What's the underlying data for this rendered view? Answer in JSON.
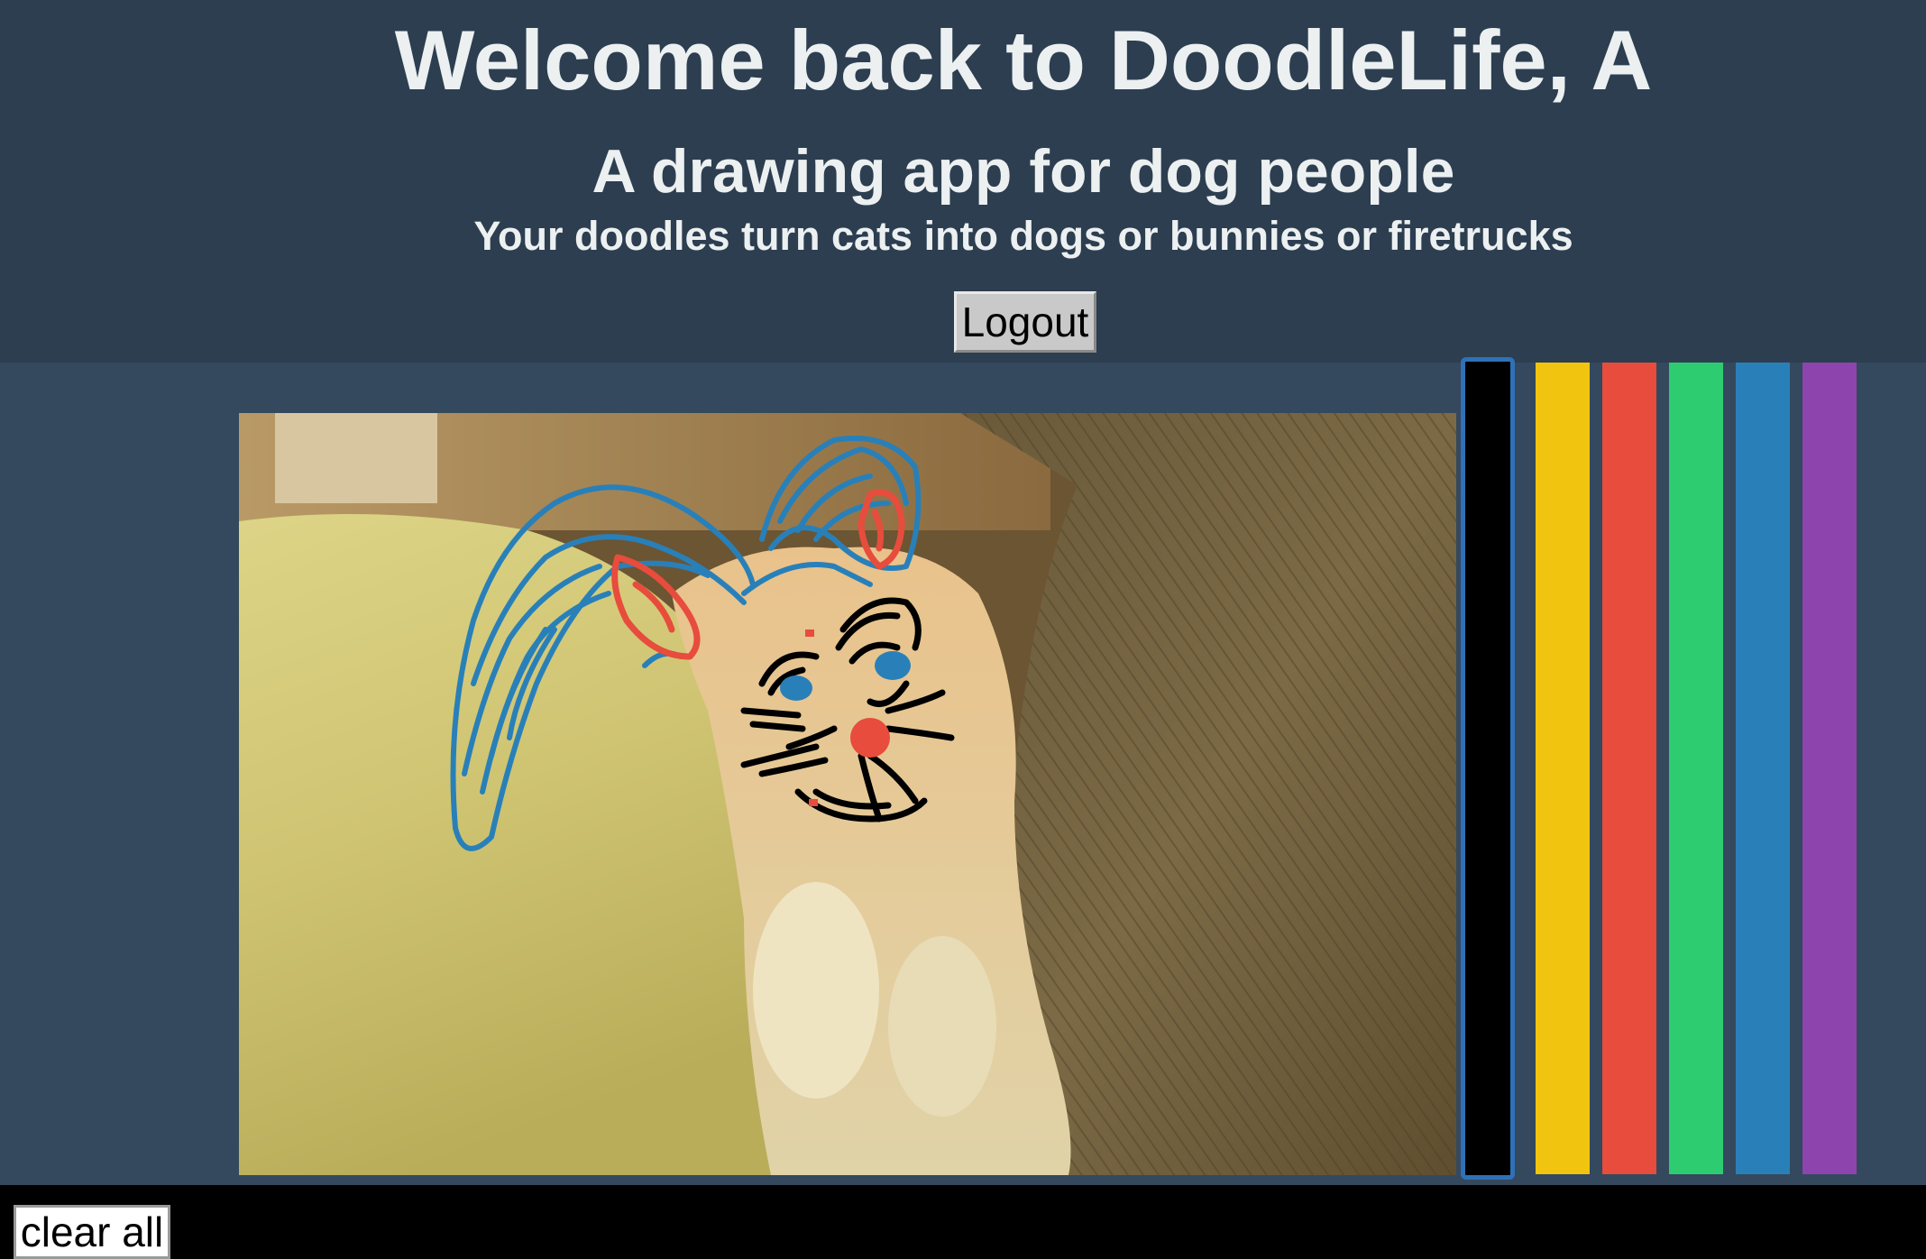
{
  "header": {
    "title": "Welcome back to DoodleLife, A",
    "subtitle": "A drawing app for dog people",
    "tagline": "Your doodles turn cats into dogs or bunnies or firetrucks",
    "logout_label": "Logout"
  },
  "palette": {
    "colors": [
      {
        "name": "black",
        "hex": "#000000",
        "selected": true
      },
      {
        "name": "yellow",
        "hex": "#f1c40f",
        "selected": false
      },
      {
        "name": "red",
        "hex": "#e74c3c",
        "selected": false
      },
      {
        "name": "green",
        "hex": "#2ecc71",
        "selected": false
      },
      {
        "name": "blue",
        "hex": "#2980b9",
        "selected": false
      },
      {
        "name": "purple",
        "hex": "#8e44ad",
        "selected": false
      }
    ]
  },
  "footer": {
    "clear_label": "clear all"
  },
  "theme": {
    "header_bg": "#2c3e50",
    "workspace_bg": "#34495e",
    "text": "#ecf0f1"
  }
}
